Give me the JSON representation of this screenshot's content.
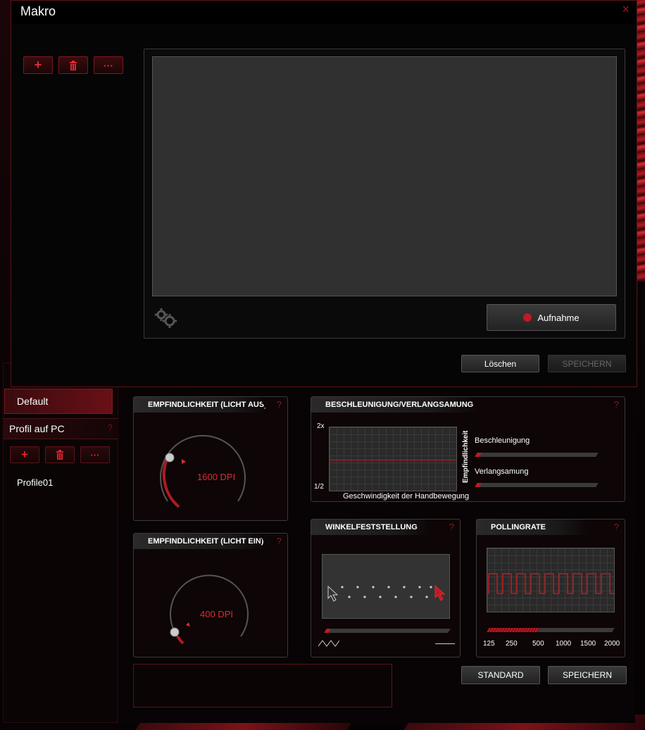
{
  "dialog": {
    "title": "Makro",
    "close_glyph": "×",
    "add_glyph": "+",
    "more_glyph": "···",
    "record_label": "Aufnahme",
    "delete_label": "Löschen",
    "save_label": "SPEICHERN"
  },
  "sidebar": {
    "default_profile": "Default",
    "section_title": "Profil auf PC",
    "help_glyph": "?",
    "add_glyph": "+",
    "more_glyph": "···",
    "profiles": [
      "Profile01"
    ]
  },
  "cards": {
    "sens_off": {
      "title": "EMPFINDLICHKEIT (LICHT AUS)",
      "value": "1600 DPI"
    },
    "sens_on": {
      "title": "EMPFINDLICHKEIT (LICHT EIN)",
      "value": "400  DPI"
    },
    "accel": {
      "title": "BESCHLEUNIGUNG/VERLANGSAMUNG",
      "y_top": "2x",
      "y_bottom": "1/2",
      "x_label": "Geschwindigkeit der Handbewegung",
      "y_label": "Empfindlichkeit",
      "accel_label": "Beschleunigung",
      "decel_label": "Verlangsamung"
    },
    "angle": {
      "title": "WINKELFESTSTELLUNG"
    },
    "polling": {
      "title": "POLLINGRATE",
      "ticks": [
        "125",
        "250",
        "500",
        "1000",
        "1500",
        "2000"
      ],
      "selected": "500"
    },
    "help_glyph": "?"
  },
  "footer": {
    "standard_label": "STANDARD",
    "save_label": "SPEICHERN"
  },
  "colors": {
    "accent": "#c01a22",
    "panel": "#0d0506",
    "border": "#3a3a3a"
  }
}
